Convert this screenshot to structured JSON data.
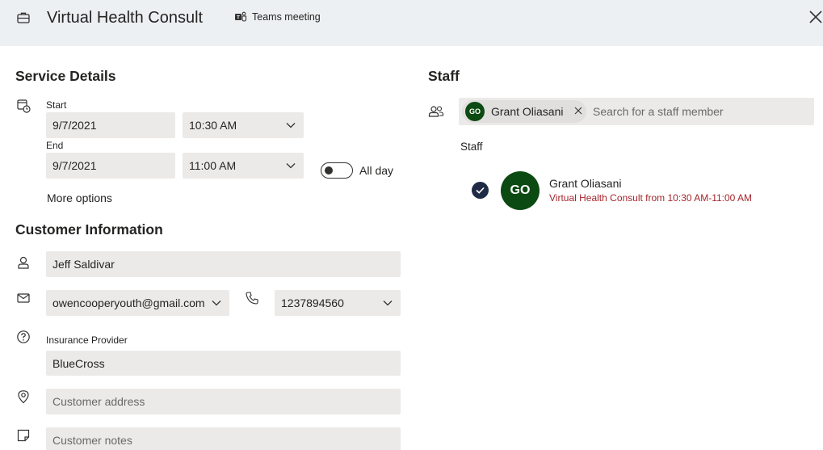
{
  "header": {
    "title": "Virtual Health Consult",
    "teams_label": "Teams meeting"
  },
  "service": {
    "title": "Service Details",
    "start_label": "Start",
    "start_date": "9/7/2021",
    "start_time": "10:30 AM",
    "end_label": "End",
    "end_date": "9/7/2021",
    "end_time": "11:00 AM",
    "all_day_label": "All day",
    "all_day_on": false,
    "more_options": "More options"
  },
  "customer": {
    "title": "Customer Information",
    "name": "Jeff Saldivar",
    "email": "owencooperyouth@gmail.com",
    "phone": "1237894560",
    "insurance_label": "Insurance Provider",
    "insurance": "BlueCross",
    "address_placeholder": "Customer address",
    "notes_placeholder": "Customer notes"
  },
  "staff": {
    "title": "Staff",
    "chip_initials": "GO",
    "chip_name": "Grant Oliasani",
    "search_placeholder": "Search for a staff member",
    "list_label": "Staff",
    "member": {
      "initials": "GO",
      "name": "Grant Oliasani",
      "detail": "Virtual Health Consult from 10:30 AM-11:00 AM",
      "selected": true
    }
  },
  "colors": {
    "header_bg": "#edf0f3",
    "field_bg": "#eceae8",
    "avatar_bg": "#0b4a12",
    "detail_text": "#a4262c",
    "check_bg": "#1f2a44"
  }
}
